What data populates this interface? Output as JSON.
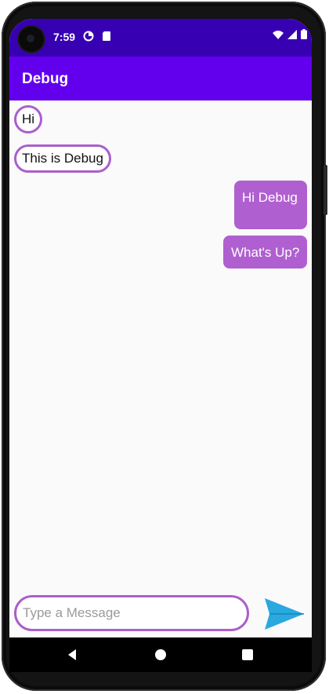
{
  "status_bar": {
    "time": "7:59",
    "left_icons": [
      "data-saver-icon",
      "sd-card-icon"
    ],
    "right_icons": [
      "wifi-icon",
      "cellular-signal-icon",
      "battery-icon"
    ]
  },
  "app_bar": {
    "title": "Debug"
  },
  "messages": [
    {
      "side": "received",
      "text": "Hi"
    },
    {
      "side": "received",
      "text": "This is Debug"
    },
    {
      "side": "sent",
      "text": "Hi Debug"
    },
    {
      "side": "sent",
      "text": "What's Up?"
    }
  ],
  "composer": {
    "value": "",
    "placeholder": "Type a Message",
    "send_icon": "send-icon"
  },
  "nav_bar": {
    "icons": [
      "back-icon",
      "home-icon",
      "recents-icon"
    ]
  },
  "colors": {
    "status_bar": "#3700b3",
    "app_bar": "#6200ee",
    "bubble_outline": "#ab5ecc",
    "sent_bubble": "#b05fd0",
    "send_icon": "#2aa8e0"
  }
}
